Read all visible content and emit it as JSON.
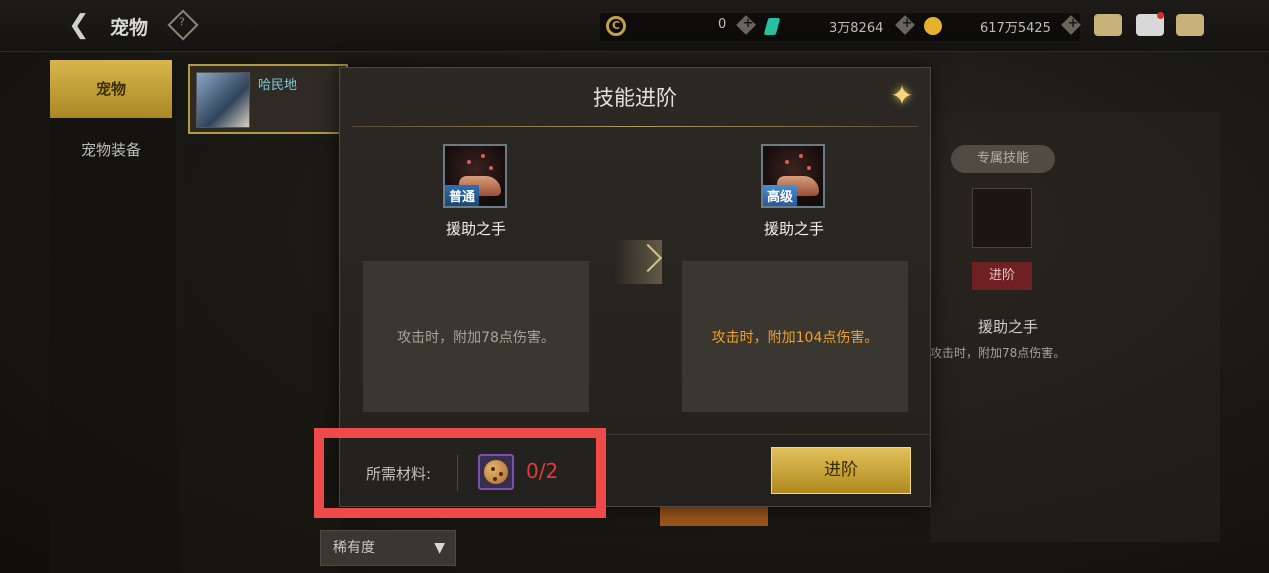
{
  "header": {
    "title": "宠物",
    "currencies": [
      {
        "icon": "c-coin-icon",
        "value": "0"
      },
      {
        "icon": "gem-icon",
        "value": "3万8264"
      },
      {
        "icon": "gold-coin-icon",
        "value": "617万5425"
      }
    ]
  },
  "sidebar": {
    "tabs": [
      {
        "label": "宠物",
        "active": true
      },
      {
        "label": "宠物装备",
        "active": false
      }
    ]
  },
  "pet_list": {
    "selected_pet": "哈民地",
    "rarity_filter": "稀有度"
  },
  "background_panel": {
    "exclusive_label": "专属技能",
    "upgrade_label": "进阶",
    "skill_name": "援助之手",
    "skill_desc": "攻击时，附加78点伤害。"
  },
  "modal": {
    "title": "技能进阶",
    "current_skill": {
      "tag": "普通",
      "name": "援助之手",
      "description": "攻击时，附加78点伤害。"
    },
    "next_skill": {
      "tag": "高级",
      "name": "援助之手",
      "description": "攻击时，附加104点伤害。"
    },
    "materials_label": "所需材料:",
    "material_count": "0/2",
    "advance_button": "进阶"
  },
  "colors": {
    "accent_gold": "#d9b64d",
    "highlight_red": "#ef4a4a",
    "desc_orange": "#f2a128",
    "count_red": "#e43a3a"
  }
}
